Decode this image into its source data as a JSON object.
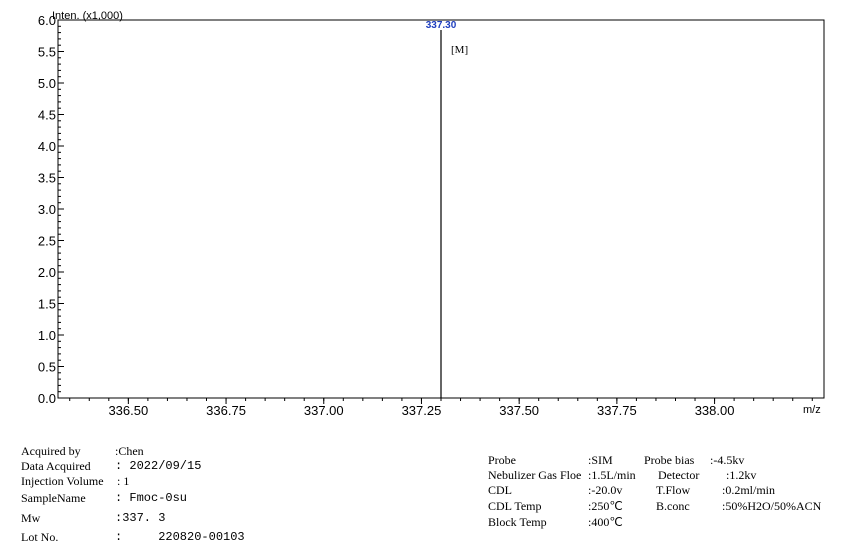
{
  "chart_data": {
    "type": "line",
    "subtype": "mass-spectrum-stick",
    "ylabel": "Inten. (x1,000)",
    "xlabel": "m/z",
    "xlim": [
      336.32,
      338.28
    ],
    "ylim": [
      0.0,
      6.0
    ],
    "x_ticks": [
      "336.50",
      "336.75",
      "337.00",
      "337.25",
      "337.50",
      "337.75",
      "338.00"
    ],
    "x_tick_values": [
      336.5,
      336.75,
      337.0,
      337.25,
      337.5,
      337.75,
      338.0
    ],
    "y_ticks": [
      "0.0",
      "0.5",
      "1.0",
      "1.5",
      "2.0",
      "2.5",
      "3.0",
      "3.5",
      "4.0",
      "4.5",
      "5.0",
      "5.5",
      "6.0"
    ],
    "y_tick_values": [
      0.0,
      0.5,
      1.0,
      1.5,
      2.0,
      2.5,
      3.0,
      3.5,
      4.0,
      4.5,
      5.0,
      5.5,
      6.0
    ],
    "peaks": [
      {
        "x": 337.3,
        "y": 6.0,
        "label": "337.30",
        "annotation": "[M]"
      }
    ],
    "color": "#000000",
    "peak_label_color": "#1f3fbf"
  },
  "left_info": [
    {
      "label": "Acquired by",
      "value": ":Chen"
    },
    {
      "label": "Data Acquired",
      "value": ": 2022/09/15"
    },
    {
      "label": "Injection Volume",
      "value": ": 1"
    },
    {
      "label": "SampleName",
      "value": ": Fmoc-0su"
    },
    {
      "label": "Mw",
      "value": ":337. 3"
    },
    {
      "label": "Lot No.",
      "value": ":     220820-00103"
    }
  ],
  "right_info": {
    "col1": [
      {
        "label": "Probe",
        "value": ":SIM"
      },
      {
        "label": "Nebulizer Gas Floe",
        "value": ":1.5L/min"
      },
      {
        "label": "CDL",
        "value": ":-20.0v"
      },
      {
        "label": "CDL Temp",
        "value": ":250℃"
      },
      {
        "label": "Block Temp",
        "value": ":400℃"
      }
    ],
    "col2": [
      {
        "label": "Probe bias",
        "value": ":-4.5kv"
      },
      {
        "label": "Detector",
        "value": ":1.2kv"
      },
      {
        "label": "T.Flow",
        "value": ":0.2ml/min"
      },
      {
        "label": "B.conc",
        "value": ":50%H2O/50%ACN"
      }
    ]
  }
}
